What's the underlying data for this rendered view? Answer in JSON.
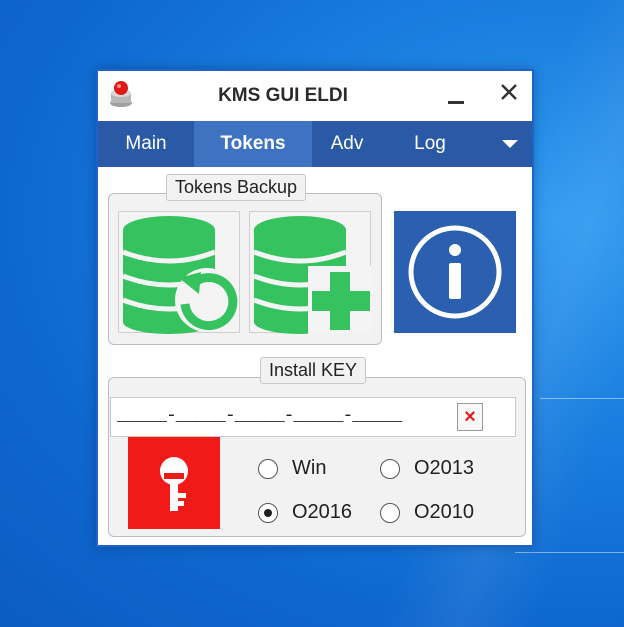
{
  "window": {
    "title": "KMS GUI ELDI"
  },
  "tabs": [
    {
      "label": "Main",
      "active": false
    },
    {
      "label": "Tokens",
      "active": true
    },
    {
      "label": "Adv",
      "active": false
    },
    {
      "label": "Log",
      "active": false
    }
  ],
  "tokens_backup": {
    "group_label": "Tokens Backup",
    "restore_icon": "database-restore-icon",
    "backup_icon": "database-add-icon",
    "info_icon": "info-icon"
  },
  "install_key": {
    "group_label": "Install KEY",
    "key_value": "_____-_____-_____-_____-_____",
    "clear_label": "×",
    "key_icon": "key-icon",
    "options": [
      {
        "label": "Win",
        "checked": false
      },
      {
        "label": "O2013",
        "checked": false
      },
      {
        "label": "O2016",
        "checked": true
      },
      {
        "label": "O2010",
        "checked": false
      }
    ]
  },
  "colors": {
    "tab_bar": "#2a5aa6",
    "tab_active": "#3e73c2",
    "token_green": "#36c25f",
    "info_blue": "#2b5fb0",
    "key_red": "#f21919",
    "desktop_blue": "#1a7fe0"
  }
}
